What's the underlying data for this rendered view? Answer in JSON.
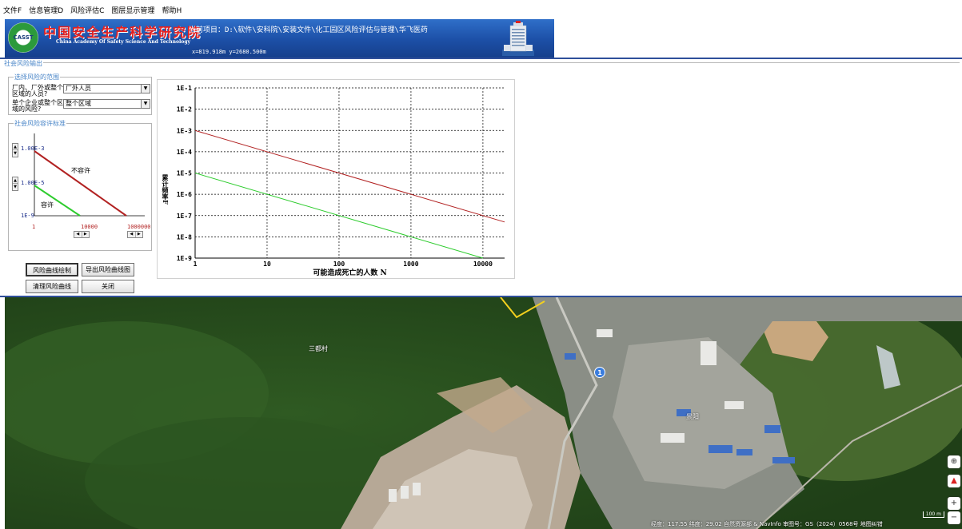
{
  "menu": [
    "文件F",
    "信息管理D",
    "风险评估C",
    "图层显示管理",
    "帮助H"
  ],
  "banner": {
    "logo_text": "CASST",
    "title_cn": "中国安全生产科学研究院",
    "title_en": "China Academy Of Safety Science And Technology",
    "project": "当前项目：D:\\软件\\安科院\\安装文件\\化工园区风险评估与管理\\华飞医药",
    "coords": "x=819.918m  y=2680.500m"
  },
  "panel": {
    "title": "社会风险输出",
    "range_group": "选择风险的范围",
    "row1_label": "厂内、厂外或整个区域的人员?",
    "row1_value": "厂外人员",
    "row2_label": "单个企业或整个区域的风险?",
    "row2_value": "整个区域",
    "tol_group": "社会风险容许标准",
    "upper_value": "1.00E-3",
    "lower_value": "1.00E-5",
    "y_min_label": "1E-9",
    "x_labels": [
      "1",
      "10000",
      "1000000"
    ],
    "zone_upper": "不容许",
    "zone_lower": "容许",
    "buttons": {
      "draw": "风险曲线绘制",
      "export": "导出风险曲线图",
      "clear": "清理风险曲线",
      "close": "关闭"
    }
  },
  "colors": {
    "upper_line": "#b22222",
    "lower_line": "#2ecc2e",
    "accent": "#2f4f9a"
  },
  "chart_data": {
    "type": "line",
    "title": "",
    "xlabel": "可能造成死亡的人数 N",
    "ylabel": "累计频率F",
    "x_scale": "log",
    "y_scale": "log",
    "xlim": [
      1,
      20000
    ],
    "ylim": [
      1e-09,
      0.1
    ],
    "x_ticks": [
      "1",
      "10",
      "100",
      "1000",
      "10000"
    ],
    "y_ticks": [
      "1E-1",
      "1E-2",
      "1E-3",
      "1E-4",
      "1E-5",
      "1E-6",
      "1E-7",
      "1E-8",
      "1E-9"
    ],
    "grid": true,
    "series": [
      {
        "color": "#b22222",
        "x": [
          1,
          20000
        ],
        "y": [
          0.001,
          5e-08
        ]
      },
      {
        "color": "#2ecc2e",
        "x": [
          1,
          10000
        ],
        "y": [
          1e-05,
          1e-09
        ]
      }
    ]
  },
  "map": {
    "labels": [
      "三都村",
      "景阳"
    ],
    "marker": "1",
    "scale": "100 m",
    "footer": "经度：117.55  纬度：29.02   自然资源部 & NavInfo   审图号：GS（2024）0568号   地图纠错"
  }
}
